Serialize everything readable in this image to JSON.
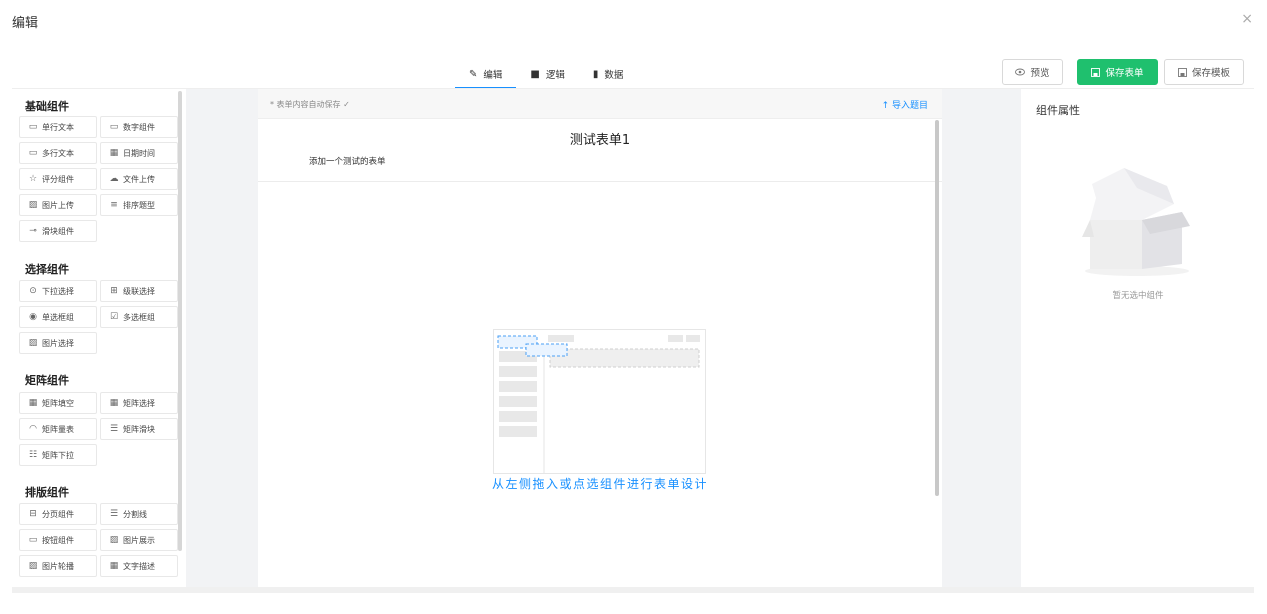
{
  "dialog": {
    "title": "编辑",
    "close": "×"
  },
  "tabs": [
    {
      "label": "编辑",
      "icon": "✎"
    },
    {
      "label": "逻辑",
      "icon": "■"
    },
    {
      "label": "数据",
      "icon": "▮"
    }
  ],
  "toolbar": {
    "preview_label": "预览",
    "save_form_label": "保存表单",
    "save_template_label": "保存模板"
  },
  "groups": [
    {
      "title": "基础组件",
      "items": [
        {
          "label": "单行文本",
          "icon": "▭"
        },
        {
          "label": "数字组件",
          "icon": "▭"
        },
        {
          "label": "多行文本",
          "icon": "▭"
        },
        {
          "label": "日期时间",
          "icon": "▦"
        },
        {
          "label": "评分组件",
          "icon": "☆"
        },
        {
          "label": "文件上传",
          "icon": "☁"
        },
        {
          "label": "图片上传",
          "icon": "▨"
        },
        {
          "label": "排序题型",
          "icon": "≡"
        },
        {
          "label": "滑块组件",
          "icon": "⊸"
        }
      ]
    },
    {
      "title": "选择组件",
      "items": [
        {
          "label": "下拉选择",
          "icon": "⊙"
        },
        {
          "label": "级联选择",
          "icon": "⊞"
        },
        {
          "label": "单选框组",
          "icon": "◉"
        },
        {
          "label": "多选框组",
          "icon": "☑"
        },
        {
          "label": "图片选择",
          "icon": "▨"
        }
      ]
    },
    {
      "title": "矩阵组件",
      "items": [
        {
          "label": "矩阵填空",
          "icon": "▦"
        },
        {
          "label": "矩阵选择",
          "icon": "▦"
        },
        {
          "label": "矩阵量表",
          "icon": "◠"
        },
        {
          "label": "矩阵滑块",
          "icon": "☰"
        },
        {
          "label": "矩阵下拉",
          "icon": "☷"
        }
      ]
    },
    {
      "title": "排版组件",
      "items": [
        {
          "label": "分页组件",
          "icon": "⊟"
        },
        {
          "label": "分割线",
          "icon": "☰"
        },
        {
          "label": "按钮组件",
          "icon": "▭"
        },
        {
          "label": "图片展示",
          "icon": "▨"
        },
        {
          "label": "图片轮播",
          "icon": "▨"
        },
        {
          "label": "文字描述",
          "icon": "▦"
        }
      ]
    }
  ],
  "form": {
    "autosave": "* 表单内容自动保存 ✓",
    "import": "↑ 导入题目",
    "title": "测试表单1",
    "description": "添加一个测试的表单",
    "empty_hint": "从左侧拖入或点选组件进行表单设计"
  },
  "properties": {
    "title": "组件属性",
    "empty": "暂无选中组件"
  },
  "colors": {
    "accent": "#1890ff",
    "save_green": "#1fc06e"
  }
}
